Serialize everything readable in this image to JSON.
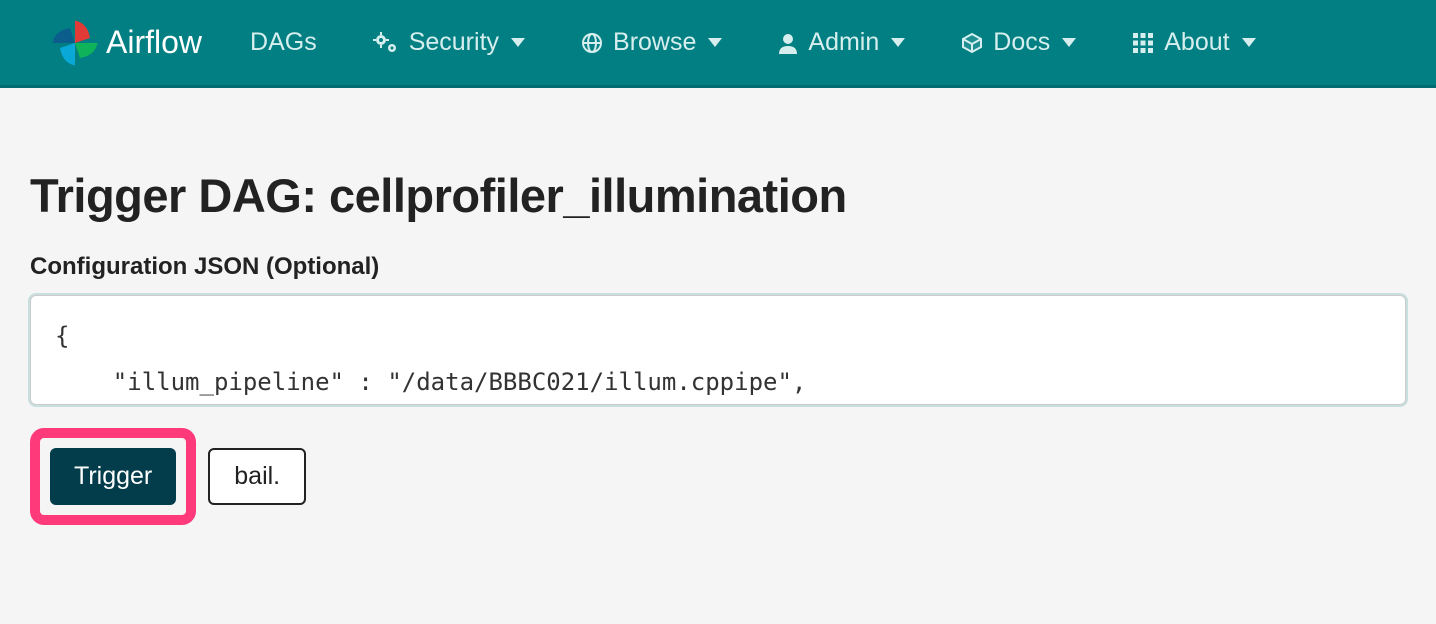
{
  "brand": {
    "name": "Airflow"
  },
  "nav": {
    "dags": "DAGs",
    "security": "Security",
    "browse": "Browse",
    "admin": "Admin",
    "docs": "Docs",
    "about": "About"
  },
  "page": {
    "title": "Trigger DAG: cellprofiler_illumination",
    "form_label": "Configuration JSON (Optional)",
    "json_value": "{\n    \"illum_pipeline\" : \"/data/BBBC021/illum.cppipe\",",
    "trigger_label": "Trigger",
    "cancel_label": "bail."
  },
  "colors": {
    "navbar_bg": "#017f82",
    "highlight": "#ff3a7a",
    "primary_btn": "#033c4a"
  }
}
